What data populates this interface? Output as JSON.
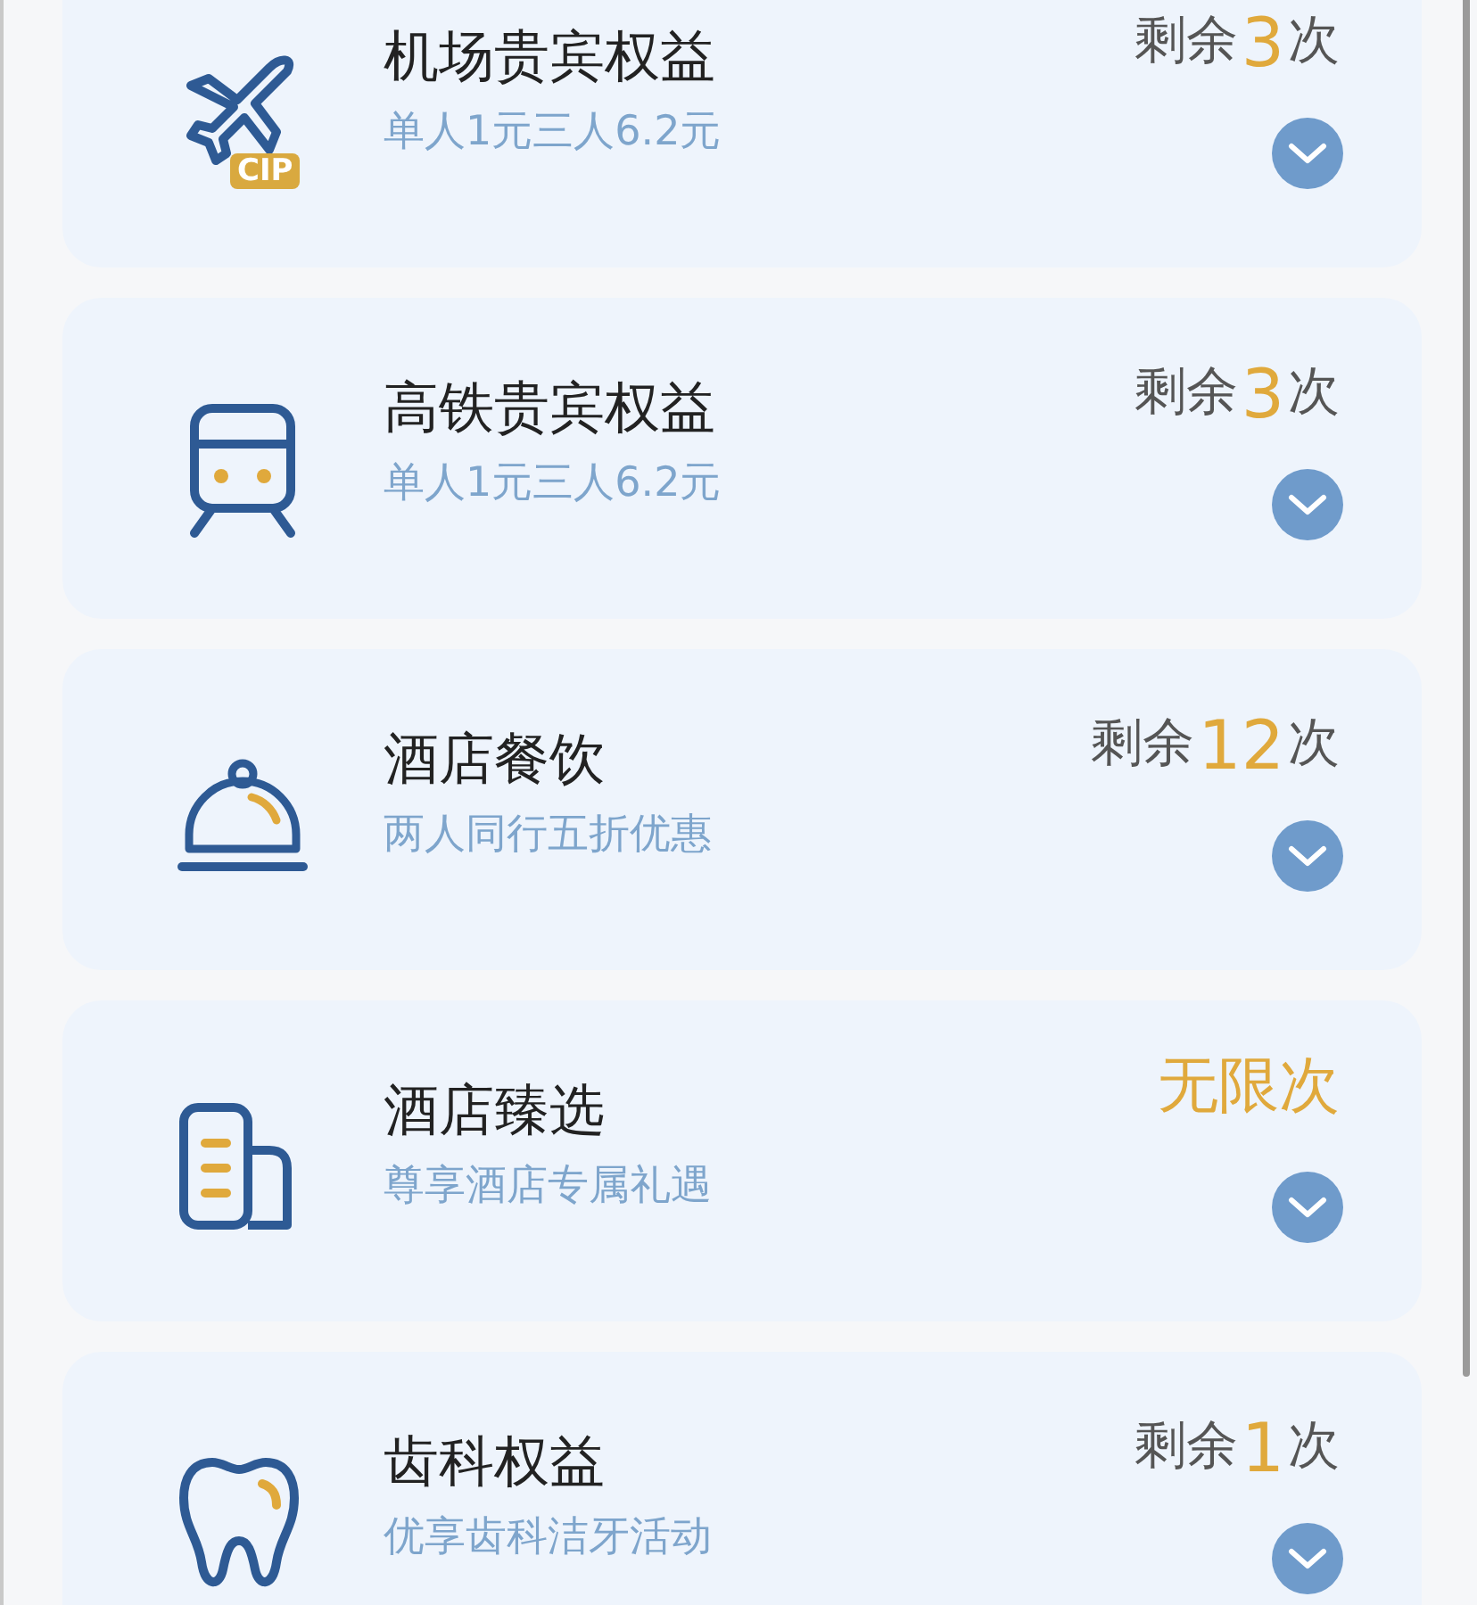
{
  "benefits": [
    {
      "title": "机场贵宾权益",
      "subtitle": "单人1元三人6.2元",
      "remaining": {
        "kind": "count",
        "prefix": "剩余",
        "count": "3",
        "suffix": "次"
      },
      "badge": "CIP"
    },
    {
      "title": "高铁贵宾权益",
      "subtitle": "单人1元三人6.2元",
      "remaining": {
        "kind": "count",
        "prefix": "剩余",
        "count": "3",
        "suffix": "次"
      }
    },
    {
      "title": "酒店餐饮",
      "subtitle": "两人同行五折优惠",
      "remaining": {
        "kind": "count",
        "prefix": "剩余",
        "count": "12",
        "suffix": "次"
      }
    },
    {
      "title": "酒店臻选",
      "subtitle": "尊享酒店专属礼遇",
      "remaining": {
        "kind": "unlimited",
        "text": "无限次"
      }
    },
    {
      "title": "齿科权益",
      "subtitle": "优享齿科洁牙活动",
      "remaining": {
        "kind": "count",
        "prefix": "剩余",
        "count": "1",
        "suffix": "次"
      }
    }
  ]
}
